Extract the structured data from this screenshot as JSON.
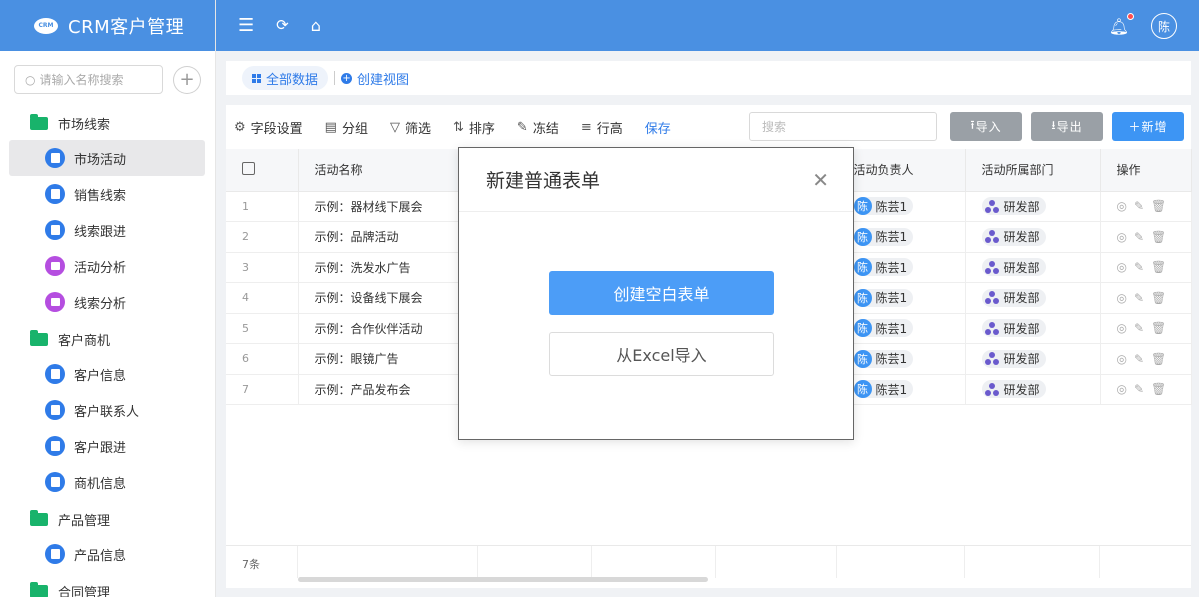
{
  "brand": {
    "logo": "CRM",
    "title": "CRM客户管理"
  },
  "sidebar": {
    "search_placeholder": "请输入名称搜索",
    "groups": [
      {
        "label": "市场线索",
        "items": [
          "市场活动",
          "销售线索",
          "线索跟进",
          "活动分析",
          "线索分析"
        ]
      },
      {
        "label": "客户商机",
        "items": [
          "客户信息",
          "客户联系人",
          "客户跟进",
          "商机信息"
        ]
      },
      {
        "label": "产品管理",
        "items": [
          "产品信息"
        ]
      },
      {
        "label": "合同管理",
        "items": []
      }
    ]
  },
  "header": {
    "avatar": "陈"
  },
  "views": {
    "all": "全部数据",
    "create": "创建视图"
  },
  "toolbar": {
    "fields": "字段设置",
    "group": "分组",
    "filter": "筛选",
    "sort": "排序",
    "freeze": "冻结",
    "row_height": "行高",
    "save": "保存",
    "search_placeholder": "搜索",
    "import": "导入",
    "export": "导出",
    "add": "新增"
  },
  "table": {
    "columns": {
      "name": "活动名称",
      "owner": "活动负责人",
      "dept": "活动所属部门",
      "ops": "操作"
    },
    "rows": [
      {
        "idx": "1",
        "name": "示例：器材线下展会",
        "owner_av": "陈",
        "owner": "陈芸1",
        "dept": "研发部"
      },
      {
        "idx": "2",
        "name": "示例：品牌活动",
        "owner_av": "陈",
        "owner": "陈芸1",
        "dept": "研发部"
      },
      {
        "idx": "3",
        "name": "示例：洗发水广告",
        "owner_av": "陈",
        "owner": "陈芸1",
        "dept": "研发部"
      },
      {
        "idx": "4",
        "name": "示例：设备线下展会",
        "owner_av": "陈",
        "owner": "陈芸1",
        "dept": "研发部"
      },
      {
        "idx": "5",
        "name": "示例：合作伙伴活动",
        "owner_av": "陈",
        "owner": "陈芸1",
        "dept": "研发部"
      },
      {
        "idx": "6",
        "name": "示例：眼镜广告",
        "owner_av": "陈",
        "owner": "陈芸1",
        "dept": "研发部"
      },
      {
        "idx": "7",
        "name": "示例：产品发布会",
        "owner_av": "陈",
        "owner": "陈芸1",
        "dept": "研发部"
      }
    ],
    "count": "7条"
  },
  "modal": {
    "title": "新建普通表单",
    "primary": "创建空白表单",
    "secondary": "从Excel导入"
  },
  "colors": {
    "brand": "#4a90e2",
    "primary": "#3d95f4",
    "folder": "#18b36b"
  }
}
